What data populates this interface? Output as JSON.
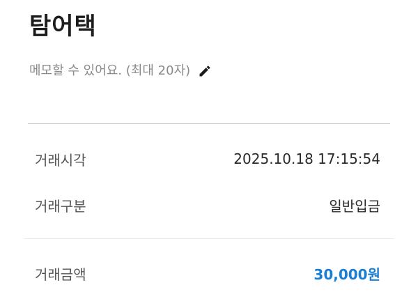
{
  "header": {
    "title": "탐어택"
  },
  "memo": {
    "placeholder": "메모할 수 있어요. (최대 20자)",
    "edit_icon": "pencil-icon"
  },
  "details": {
    "time_label": "거래시각",
    "time_value": "2025.10.18 17:15:54",
    "type_label": "거래구분",
    "type_value": "일반입금",
    "amount_label": "거래금액",
    "amount_value": "30,000원"
  },
  "colors": {
    "amount": "#1a7fd4",
    "memo_text": "#8a8a8a",
    "divider": "#c9c9c9"
  }
}
